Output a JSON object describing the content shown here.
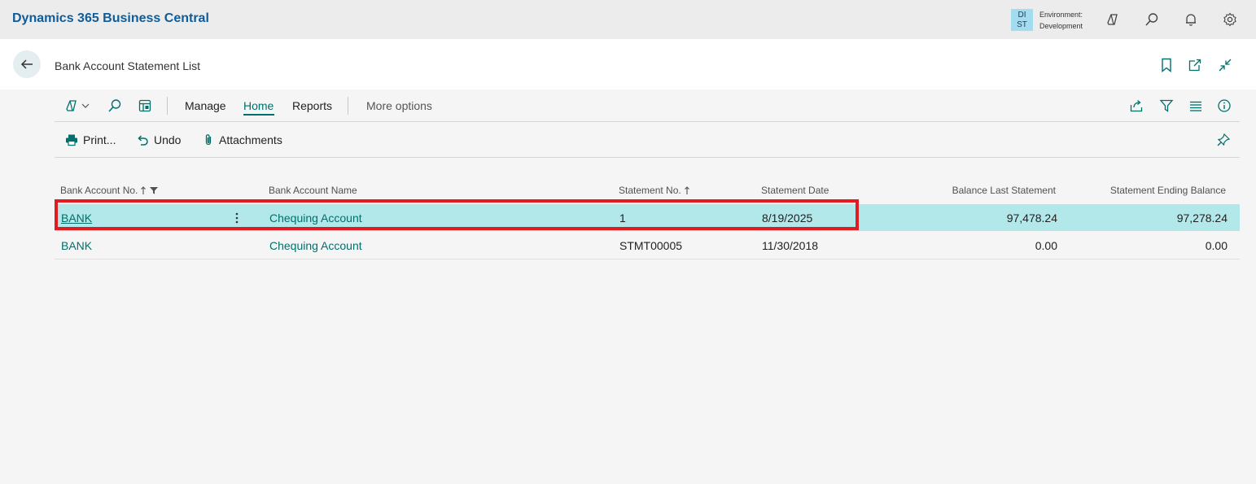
{
  "app": {
    "title": "Dynamics 365 Business Central"
  },
  "environment": {
    "badge_line1": "DI",
    "badge_line2": "ST",
    "label": "Environment:",
    "value": "Development"
  },
  "page": {
    "title": "Bank Account Statement List"
  },
  "actionbar": {
    "manage": "Manage",
    "home": "Home",
    "reports": "Reports",
    "more": "More options"
  },
  "subactions": {
    "print": "Print...",
    "undo": "Undo",
    "attachments": "Attachments"
  },
  "columns": {
    "bank_account_no": "Bank Account No.",
    "bank_account_name": "Bank Account Name",
    "statement_no": "Statement No.",
    "statement_date": "Statement Date",
    "balance_last": "Balance Last Statement",
    "ending_balance": "Statement Ending Balance"
  },
  "rows": [
    {
      "bank_account_no": "BANK",
      "bank_account_name": "Chequing Account",
      "statement_no": "1",
      "statement_date": "8/19/2025",
      "balance_last": "97,478.24",
      "ending_balance": "97,278.24"
    },
    {
      "bank_account_no": "BANK",
      "bank_account_name": "Chequing Account",
      "statement_no": "STMT00005",
      "statement_date": "11/30/2018",
      "balance_last": "0.00",
      "ending_balance": "0.00"
    }
  ],
  "icons": {
    "copilot": "copilot-icon",
    "search": "search-icon",
    "bell": "bell-icon",
    "gear": "gear-icon",
    "back": "back-arrow-icon",
    "bookmark": "bookmark-icon",
    "open-new": "open-new-window-icon",
    "collapse": "collapse-icon"
  },
  "colors": {
    "accent": "#00706b",
    "brand": "#0f5c99",
    "selected_row": "#b3e8eb",
    "highlight": "#e01b22"
  }
}
